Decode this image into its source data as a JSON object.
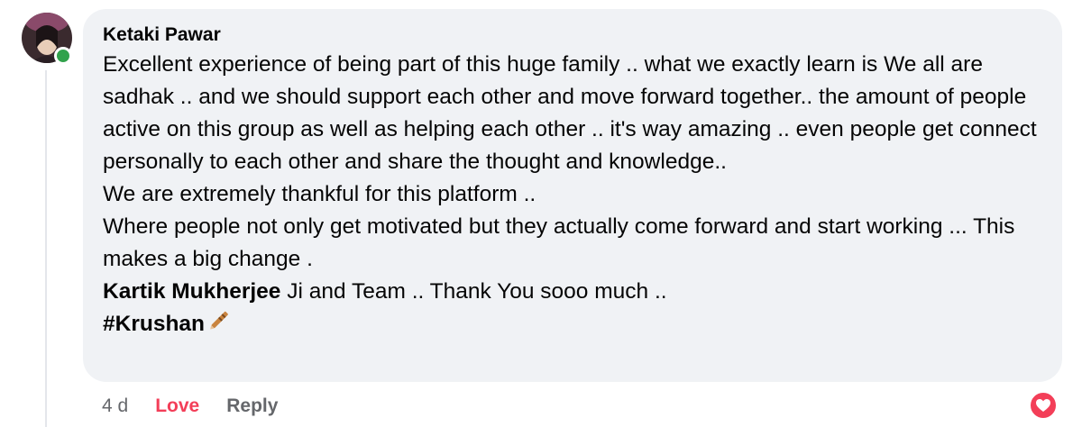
{
  "comment": {
    "author": "Ketaki Pawar",
    "paragraphs": [
      "Excellent experience of being part of this huge family .. what we exactly learn is We all are sadhak .. and we should support each other and move forward together.. the amount of people active on this group as well as helping each other .. it's way amazing .. even people get connect personally to each other and share the thought and knowledge..",
      "We are extremely thankful for this platform ..",
      "Where people not only get motivated but they actually come forward and start working ... This makes a big change ."
    ],
    "mention": "Kartik Mukherjee",
    "mention_suffix": " Ji and Team .. Thank You sooo much ..",
    "hashtag": "#Krushan"
  },
  "actions": {
    "time": "4 d",
    "love_label": "Love",
    "reply_label": "Reply"
  },
  "icons": {
    "avatar": "user-avatar",
    "status": "online-status-dot",
    "hashtag_emoji": "pencil-flute-icon",
    "reaction": "love-reaction-icon"
  },
  "colors": {
    "bubble": "#f0f2f5",
    "text": "#050505",
    "muted": "#65676b",
    "love": "#f33e58",
    "online": "#31a24c"
  }
}
